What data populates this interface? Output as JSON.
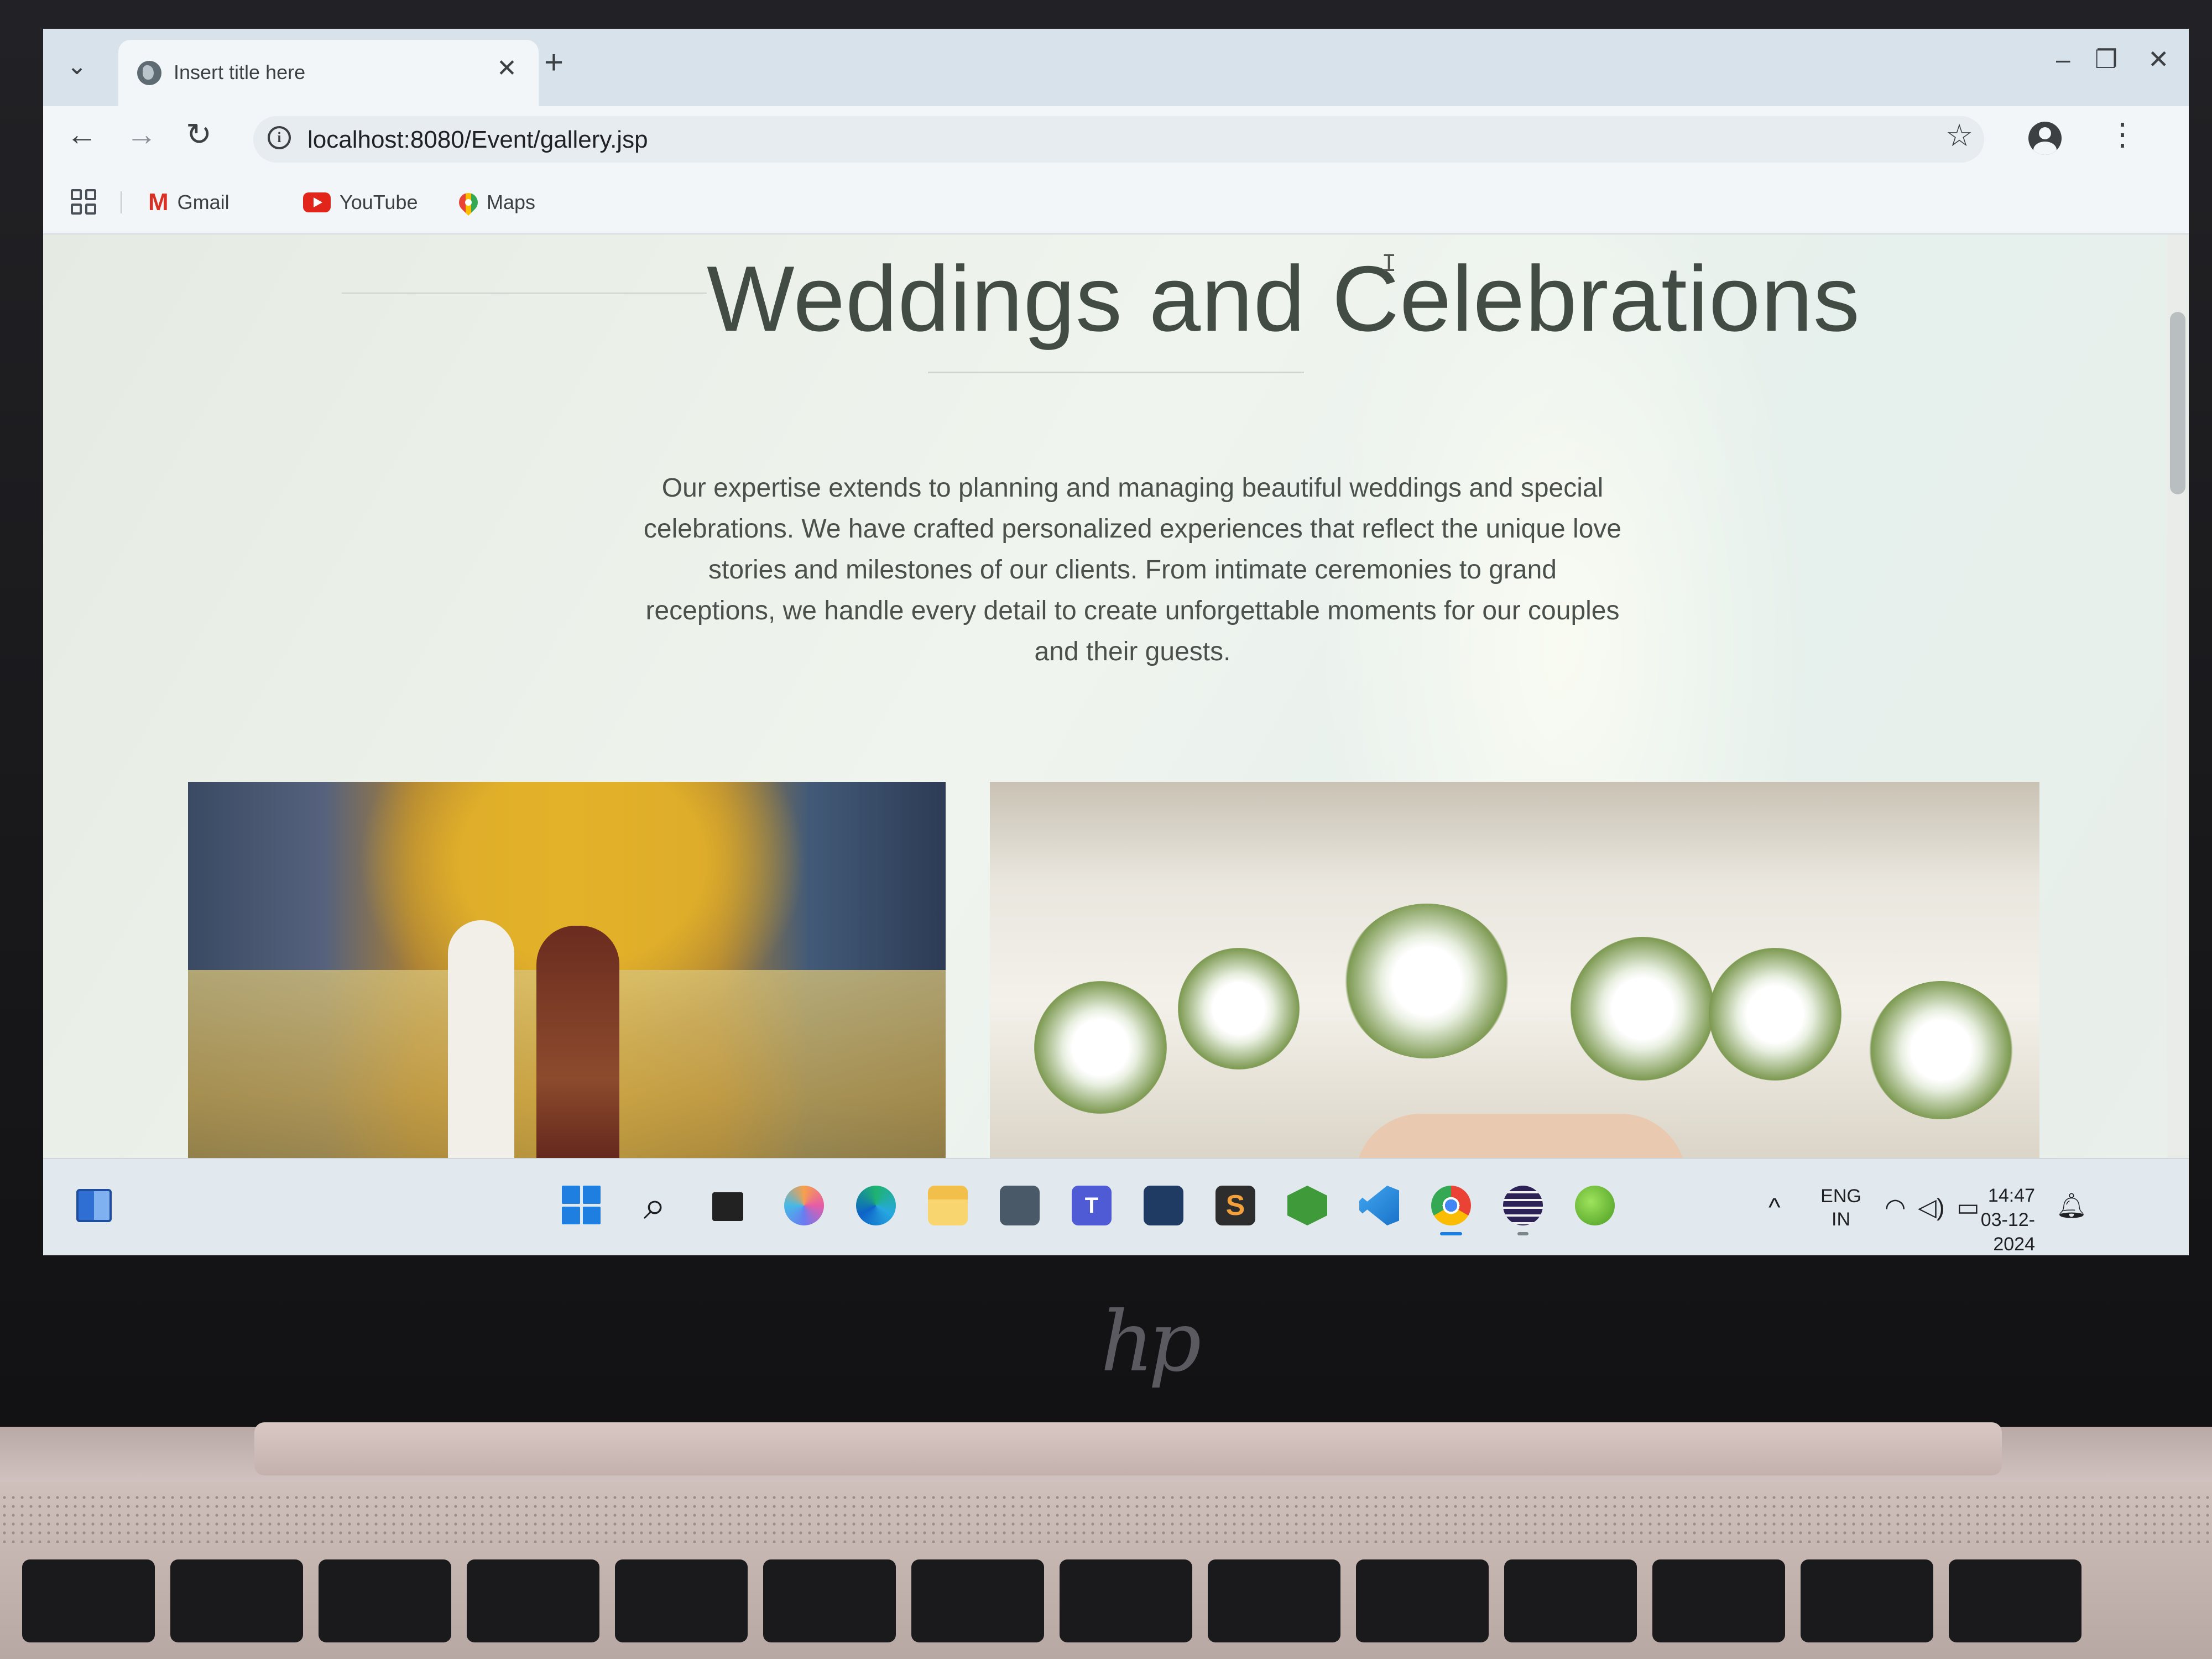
{
  "browser": {
    "tab_title": "Insert title here",
    "tab_close": "✕",
    "new_tab": "+",
    "tab_menu": "⌄",
    "window_controls": {
      "minimize": "–",
      "restore": "❐",
      "close": "✕"
    },
    "nav": {
      "back": "←",
      "forward": "→",
      "reload": "↻"
    },
    "url": "localhost:8080/Event/gallery.jsp",
    "bookmark_star": "☆",
    "menu": "⋮",
    "bookmarks": [
      {
        "label": "Gmail",
        "icon": "gmail-icon"
      },
      {
        "label": "YouTube",
        "icon": "youtube-icon"
      },
      {
        "label": "Maps",
        "icon": "maps-icon"
      }
    ]
  },
  "page": {
    "title": "Weddings and Celebrations",
    "intro": "Our expertise extends to planning and managing beautiful weddings and special celebrations. We have crafted personalized experiences that reflect the unique love stories and milestones of our clients. From intimate ceremonies to grand receptions, we handle every detail to create unforgettable moments for our couples and their guests.",
    "images": [
      {
        "subject": "wedding-couple-photo"
      },
      {
        "subject": "floral-stage-decor-photo"
      }
    ]
  },
  "taskbar": {
    "apps": [
      "widgets",
      "start",
      "search",
      "task-view",
      "copilot",
      "edge",
      "file-explorer",
      "camera",
      "teams",
      "mysql-workbench",
      "sublime-text",
      "nodejs",
      "vscode",
      "chrome",
      "eclipse",
      "spring-tools"
    ],
    "search_glyph": "⌕",
    "teams_label": "T",
    "sublime_label": "S",
    "tray_chevron": "^",
    "language_line1": "ENG",
    "language_line2": "IN",
    "time": "14:47",
    "date": "03-12-2024",
    "accent": "#1e7fe0"
  },
  "colors": {
    "title_text": "#434b45",
    "body_text": "#4a504b",
    "page_bg": "#eef2ec"
  }
}
